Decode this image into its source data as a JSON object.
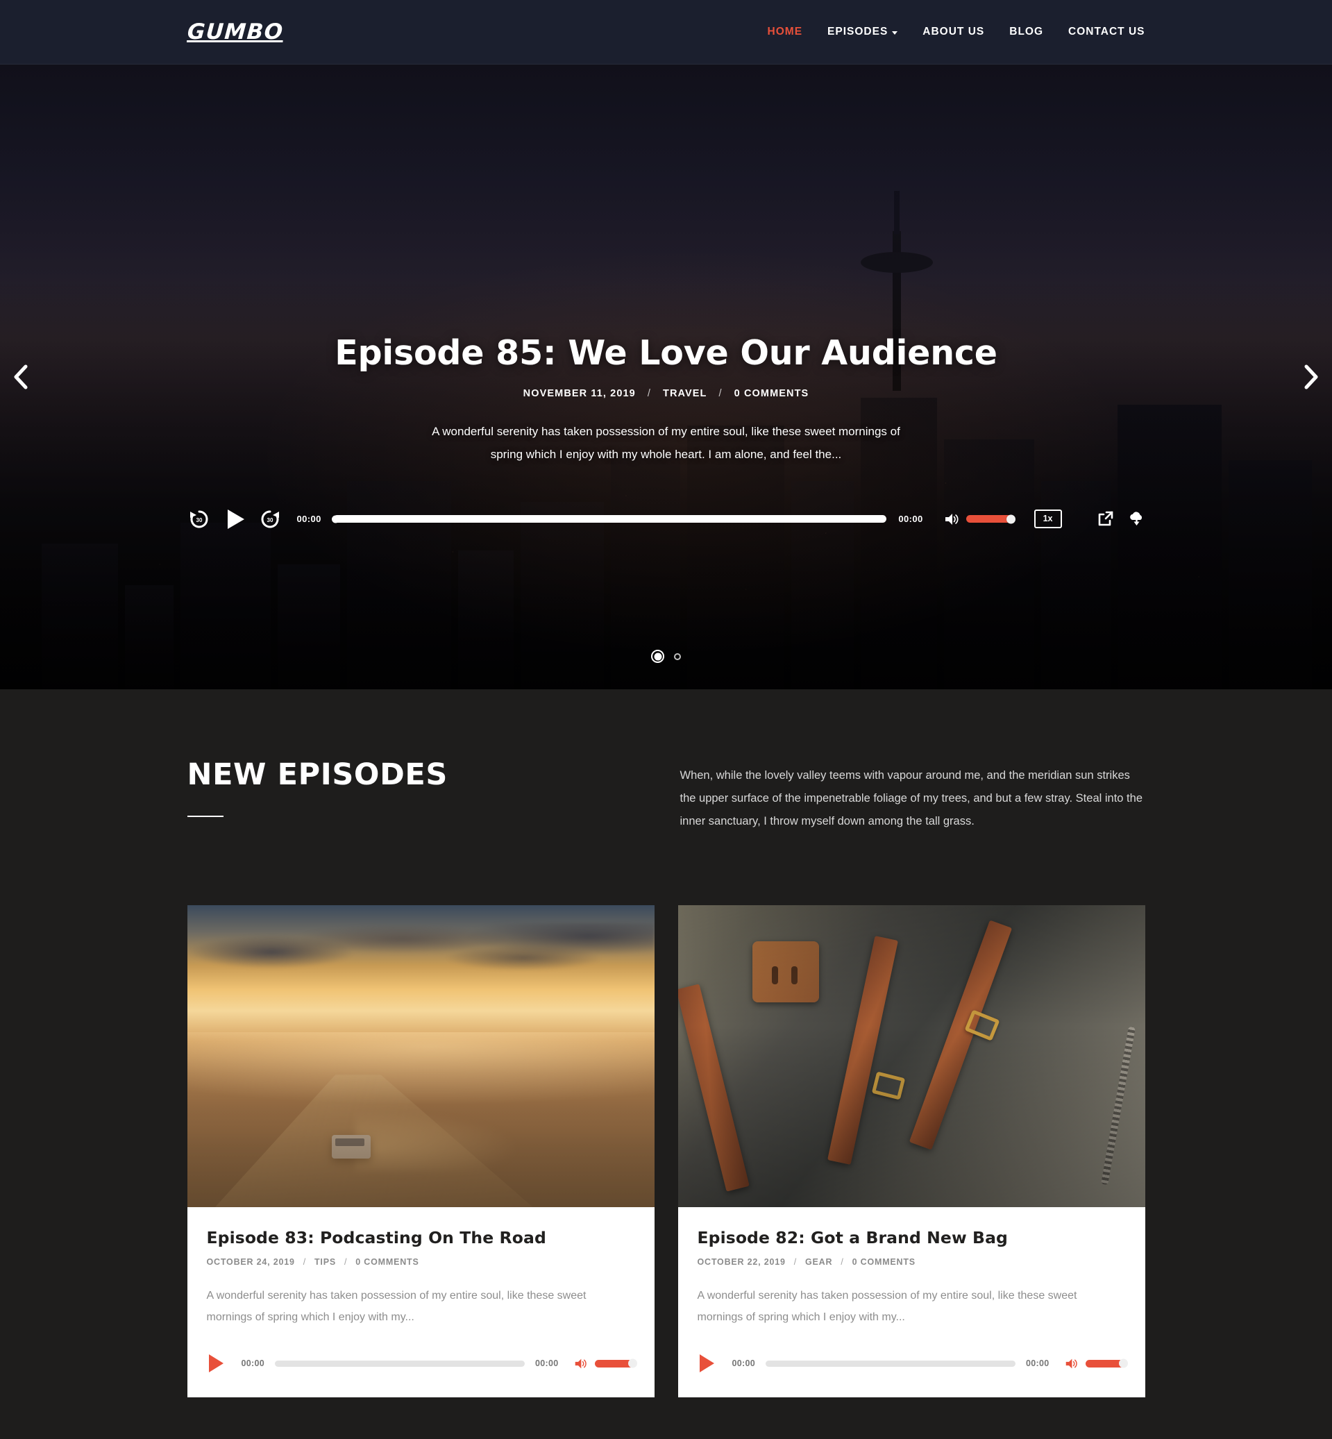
{
  "brand": {
    "logo": "GUMBO"
  },
  "nav": {
    "items": [
      {
        "label": "HOME",
        "active": true,
        "caret": false
      },
      {
        "label": "EPISODES",
        "active": false,
        "caret": true
      },
      {
        "label": "ABOUT US",
        "active": false,
        "caret": false
      },
      {
        "label": "BLOG",
        "active": false,
        "caret": false
      },
      {
        "label": "CONTACT US",
        "active": false,
        "caret": false
      }
    ]
  },
  "colors": {
    "accent": "#e8503a",
    "header_bg": "#1b1f2e",
    "section_bg": "#1e1d1c",
    "card_bg": "#ffffff"
  },
  "hero": {
    "title": "Episode 85: We Love Our Audience",
    "date": "NOVEMBER 11, 2019",
    "category": "TRAVEL",
    "comments": "0 COMMENTS",
    "separator": "/",
    "description": "A wonderful serenity has taken possession of my entire soul, like these sweet mornings of spring which I enjoy with my whole heart. I am alone, and feel the...",
    "prev_arrow": "chevron-left-icon",
    "next_arrow": "chevron-right-icon",
    "slides": [
      {
        "index": 1,
        "active": true
      },
      {
        "index": 2,
        "active": false
      }
    ],
    "player": {
      "rewind_label": "30",
      "forward_label": "30",
      "current_time": "00:00",
      "duration": "00:00",
      "speed": "1x",
      "progress_percent": 0,
      "volume_percent": 100,
      "icons": {
        "rewind": "rewind-30-icon",
        "play": "play-icon",
        "forward": "forward-30-icon",
        "volume": "volume-icon",
        "share": "share-icon",
        "download": "download-icon"
      }
    }
  },
  "episodes_section": {
    "title": "NEW EPISODES",
    "lede": "When, while the lovely valley teems with vapour around me, and the meridian sun strikes the upper surface of the impenetrable foliage of my trees, and but a few stray. Steal into the inner sanctuary, I throw myself down among the tall grass.",
    "cards": [
      {
        "image_name": "desert-road-sunset-van-photo",
        "title": "Episode 83: Podcasting On The Road",
        "date": "OCTOBER 24, 2019",
        "category": "TIPS",
        "comments": "0 COMMENTS",
        "separator": "/",
        "excerpt": "A wonderful serenity has taken possession of my entire soul, like these sweet mornings of spring which I enjoy with my...",
        "player": {
          "current_time": "00:00",
          "duration": "00:00",
          "progress_percent": 0,
          "volume_percent": 100
        }
      },
      {
        "image_name": "canvas-leather-backpack-photo",
        "title": "Episode 82: Got a Brand New Bag",
        "date": "OCTOBER 22, 2019",
        "category": "GEAR",
        "comments": "0 COMMENTS",
        "separator": "/",
        "excerpt": "A wonderful serenity has taken possession of my entire soul, like these sweet mornings of spring which I enjoy with my...",
        "player": {
          "current_time": "00:00",
          "duration": "00:00",
          "progress_percent": 0,
          "volume_percent": 100
        }
      }
    ]
  }
}
